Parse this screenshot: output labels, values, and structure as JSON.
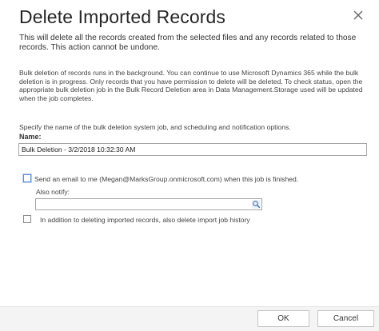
{
  "dialog": {
    "title": "Delete Imported Records",
    "close_icon": "close-icon",
    "warning": "This will delete all the records created from the selected files and any records related to those records. This action cannot be undone.",
    "info": "Bulk deletion of records runs in the background. You can continue to use Microsoft Dynamics 365 while the bulk deletion is in progress. Only records that you have permission to delete will be deleted. To check status, open the appropriate bulk deletion job in the Bulk Record Deletion area in Data Management.Storage used will be updated when the job completes.",
    "specify_text": "Specify the name of the bulk deletion system job, and scheduling and notification options.",
    "name_label": "Name:",
    "name_value": "Bulk Deletion - 3/2/2018 10:32:30 AM",
    "email_checkbox": {
      "label": "Send an email to me (Megan@MarksGroup.onmicrosoft.com) when this job is finished.",
      "checked": false
    },
    "also_notify_label": "Also notify:",
    "also_notify_value": "",
    "lookup_icon": "lookup-icon",
    "history_checkbox": {
      "label": "In addition to deleting imported records, also delete import job history",
      "checked": false
    },
    "buttons": {
      "ok": "OK",
      "cancel": "Cancel"
    }
  },
  "colors": {
    "border": "#a6a6a6",
    "focus": "#5b8fd9",
    "footer_bg": "#f4f4f4"
  }
}
